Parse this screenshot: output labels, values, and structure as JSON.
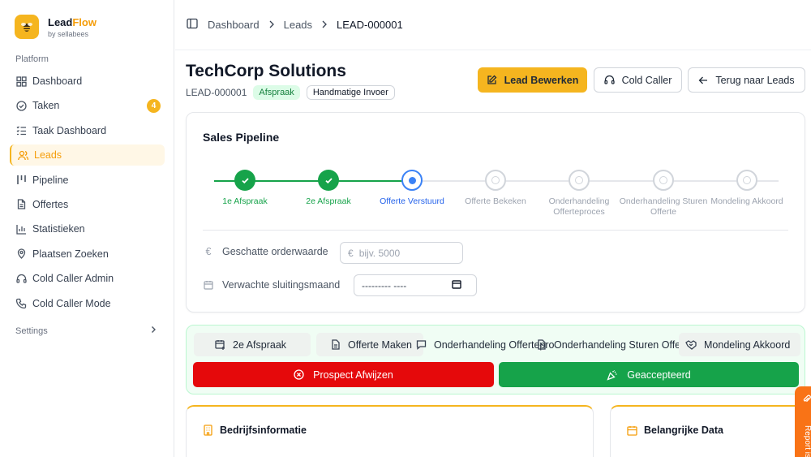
{
  "brand": {
    "name_part1": "Lead",
    "name_part2": "Flow",
    "sub": "by sellabees"
  },
  "sidebar": {
    "section": "Platform",
    "items": [
      {
        "label": "Dashboard",
        "icon": "grid-icon"
      },
      {
        "label": "Taken",
        "icon": "check-circle-icon",
        "badge": "4"
      },
      {
        "label": "Taak Dashboard",
        "icon": "list-check-icon"
      },
      {
        "label": "Leads",
        "icon": "users-icon",
        "active": true
      },
      {
        "label": "Pipeline",
        "icon": "pipeline-icon"
      },
      {
        "label": "Offertes",
        "icon": "file-icon"
      },
      {
        "label": "Statistieken",
        "icon": "bar-chart-icon"
      },
      {
        "label": "Plaatsen Zoeken",
        "icon": "map-pin-icon"
      },
      {
        "label": "Cold Caller Admin",
        "icon": "headset-icon"
      },
      {
        "label": "Cold Caller Mode",
        "icon": "phone-icon"
      }
    ],
    "settings_label": "Settings"
  },
  "breadcrumb": {
    "item1": "Dashboard",
    "item2": "Leads",
    "current": "LEAD-000001"
  },
  "header": {
    "title": "TechCorp Solutions",
    "lead_id": "LEAD-000001",
    "status_badge": "Afspraak",
    "source_badge": "Handmatige Invoer"
  },
  "buttons": {
    "edit": "Lead Bewerken",
    "cold_caller": "Cold Caller",
    "back": "Terug naar Leads"
  },
  "pipeline": {
    "title": "Sales Pipeline",
    "progress_steps_completed": 2,
    "steps": [
      {
        "label": "1e Afspraak",
        "status": "done"
      },
      {
        "label": "2e Afspraak",
        "status": "done"
      },
      {
        "label": "Offerte Verstuurd",
        "status": "current"
      },
      {
        "label": "Offerte Bekeken",
        "status": "todo"
      },
      {
        "label": "Onderhandeling Offerteproces",
        "status": "todo"
      },
      {
        "label": "Onderhandeling Sturen Offerte",
        "status": "todo"
      },
      {
        "label": "Mondeling Akkoord",
        "status": "todo"
      }
    ],
    "order_value": {
      "label": "Geschatte orderwaarde",
      "currency": "€",
      "placeholder": "bijv. 5000"
    },
    "close_month": {
      "label": "Verwachte sluitingsmaand",
      "value": "--------- ----"
    },
    "colors": {
      "done": "#16a34a",
      "current": "#3b82f6",
      "todo": "#d1d5db"
    }
  },
  "actions": {
    "quick": [
      "2e Afspraak",
      "Offerte Maken",
      "Onderhandeling Offerteproces",
      "Onderhandeling Sturen Offerte",
      "Mondeling Akkoord"
    ],
    "reject": "Prospect Afwijzen",
    "accept": "Geaccepteerd"
  },
  "sections": {
    "company": "Bedrijfsinformatie",
    "dates": "Belangrijke Data"
  },
  "report": {
    "label": "Report issue"
  }
}
